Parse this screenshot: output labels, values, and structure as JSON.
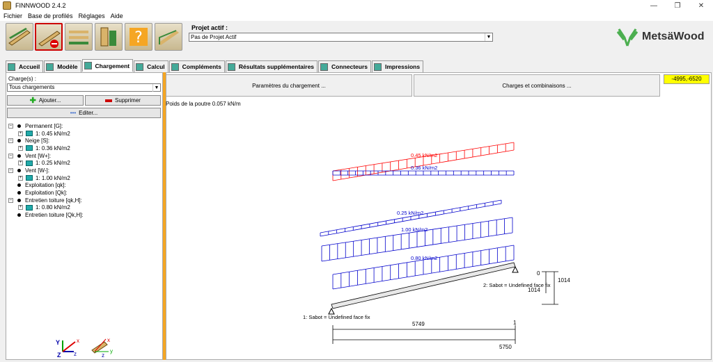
{
  "app": {
    "title": "FINNWOOD 2.4.2"
  },
  "menu": [
    "Fichier",
    "Base de profilés",
    "Réglages",
    "Aide"
  ],
  "project": {
    "label": "Projet actif :",
    "value": "Pas de Projet Actif"
  },
  "logo": {
    "text": "MetsäWood"
  },
  "tabs": [
    {
      "label": "Accueil"
    },
    {
      "label": "Modèle"
    },
    {
      "label": "Chargement"
    },
    {
      "label": "Calcul"
    },
    {
      "label": "Compléments"
    },
    {
      "label": "Résultats supplémentaires"
    },
    {
      "label": "Connecteurs"
    },
    {
      "label": "Impressions"
    }
  ],
  "left": {
    "charges_label": "Charge(s) :",
    "charges_value": "Tous chargements",
    "add_label": "Ajouter...",
    "delete_label": "Supprimer",
    "edit_label": "Editer..."
  },
  "tree": [
    {
      "label": "Permanent [G]:",
      "level": 1,
      "expand": "-"
    },
    {
      "label": "1: 0.45 kN/m2",
      "level": 2,
      "expand": "+"
    },
    {
      "label": "Neige [S]:",
      "level": 1,
      "expand": "-"
    },
    {
      "label": "1: 0.36 kN/m2",
      "level": 2,
      "expand": "+"
    },
    {
      "label": "Vent [W+]:",
      "level": 1,
      "expand": "-"
    },
    {
      "label": "1: 0.25 kN/m2",
      "level": 2,
      "expand": "+"
    },
    {
      "label": "Vent [W-]:",
      "level": 1,
      "expand": "-"
    },
    {
      "label": "1: 1.00 kN/m2",
      "level": 2,
      "expand": "+"
    },
    {
      "label": "Exploitation [qk]:",
      "level": 1,
      "expand": ""
    },
    {
      "label": "Exploitation [Qk]:",
      "level": 1,
      "expand": ""
    },
    {
      "label": "Entretien toiture [qk,H]:",
      "level": 1,
      "expand": "-"
    },
    {
      "label": "1: 0.80 kN/m2",
      "level": 2,
      "expand": "+"
    },
    {
      "label": "Entretien toiture [Qk,H]:",
      "level": 1,
      "expand": ""
    }
  ],
  "right": {
    "params_label": "Paramètres du chargement ...",
    "charges_comb_label": "Charges et combinaisons ...",
    "coord": "-4995,-6520",
    "poids": "Poids de la poutre 0.057 kN/m"
  },
  "drawing": {
    "loads": [
      "0.45 kN/m2",
      "0.36 kN/m2",
      "0.25 kN/m2",
      "1.00 kN/m2",
      "0.80 kN/m2"
    ],
    "support1": "1: Sabot = Undefined face fix",
    "support2": "2: Sabot = Undefined face fix",
    "dim_5749": "5749",
    "dim_1": "1",
    "dim_5750": "5750",
    "dim_1014a": "1014",
    "dim_1014b": "1014",
    "dim_0": "0",
    "colors": {
      "red": "#ff0000",
      "blue": "#0000cc"
    }
  },
  "axes": {
    "x": "x",
    "y": "y",
    "z": "z",
    "Y": "Y",
    "Z": "Z",
    "X": "X"
  }
}
